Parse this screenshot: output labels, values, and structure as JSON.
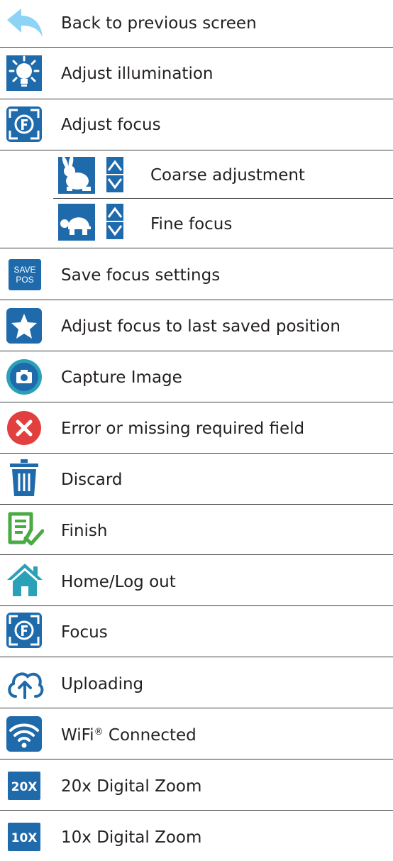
{
  "colors": {
    "primary_blue": "#1f6aab",
    "teal": "#2aa1b8",
    "light_blue": "#8cd3f5",
    "green": "#4aab45",
    "red": "#e2403f",
    "separator": "#3d3d3d"
  },
  "legend": [
    {
      "icon": "back-arrow-icon",
      "label": "Back to previous screen"
    },
    {
      "icon": "illumination-bulb-icon",
      "label": "Adjust illumination"
    },
    {
      "icon": "focus-f-icon",
      "label": "Adjust focus"
    },
    {
      "icon": "rabbit-icon",
      "label": "Coarse adjustment"
    },
    {
      "icon": "turtle-icon",
      "label": "Fine focus"
    },
    {
      "icon": "save-pos-icon",
      "icon_text": [
        "SAVE",
        "POS"
      ],
      "label": "Save focus settings"
    },
    {
      "icon": "star-icon",
      "label": "Adjust focus to last saved position"
    },
    {
      "icon": "camera-icon",
      "label": "Capture Image"
    },
    {
      "icon": "error-x-icon",
      "label": "Error or missing required field"
    },
    {
      "icon": "trash-icon",
      "label": "Discard"
    },
    {
      "icon": "finish-document-icon",
      "label": "Finish"
    },
    {
      "icon": "home-icon",
      "label": "Home/Log out"
    },
    {
      "icon": "focus-f-icon",
      "label": "Focus"
    },
    {
      "icon": "cloud-upload-icon",
      "label": "Uploading"
    },
    {
      "icon": "wifi-icon",
      "label": "WiFi",
      "label_sup": "®",
      "label_suffix": " Connected"
    },
    {
      "icon": "zoom-20x-icon",
      "icon_text": "20X",
      "label": "20x Digital Zoom"
    },
    {
      "icon": "zoom-10x-icon",
      "icon_text": "10X",
      "label": "10x Digital Zoom"
    }
  ]
}
